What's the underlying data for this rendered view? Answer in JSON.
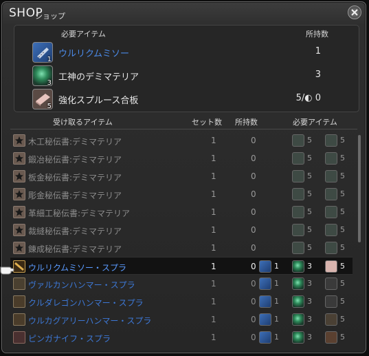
{
  "window": {
    "title": "SHOP",
    "subtitle": "ショップ"
  },
  "required_panel": {
    "col_item": "必要アイテム",
    "col_owned": "所持数",
    "items": [
      {
        "name": "ウルリクムミソー",
        "count": "1",
        "owned": "1",
        "icon": "saw-icon",
        "highlight": true
      },
      {
        "name": "工神のデミマテリア",
        "count": "3",
        "owned": "3",
        "icon": "materia-icon",
        "highlight": false
      },
      {
        "name": "強化スプルース合板",
        "count": "5",
        "owned": "5/◐ 0",
        "icon": "lumber-icon",
        "highlight": false
      }
    ]
  },
  "list": {
    "col_receive": "受け取るアイテム",
    "col_sets": "セット数",
    "col_owned": "所持数",
    "col_required": "必要アイテム",
    "rows": [
      {
        "name": "木工秘伝書:デミマテリア",
        "sets": "1",
        "owned": "0",
        "mats": [
          {
            "icon": "demimateria-icon",
            "n": "5"
          },
          {
            "icon": "demimateria-icon",
            "n": "5"
          }
        ],
        "style": "dim",
        "icon": "star-book-icon"
      },
      {
        "name": "鍛冶秘伝書:デミマテリア",
        "sets": "1",
        "owned": "0",
        "mats": [
          {
            "icon": "demimateria-icon",
            "n": "5"
          },
          {
            "icon": "demimateria-icon",
            "n": "5"
          }
        ],
        "style": "dim",
        "icon": "star-book-icon"
      },
      {
        "name": "板金秘伝書:デミマテリア",
        "sets": "1",
        "owned": "0",
        "mats": [
          {
            "icon": "demimateria-icon",
            "n": "5"
          },
          {
            "icon": "demimateria-icon",
            "n": "5"
          }
        ],
        "style": "dim",
        "icon": "star-book-icon"
      },
      {
        "name": "彫金秘伝書:デミマテリア",
        "sets": "1",
        "owned": "0",
        "mats": [
          {
            "icon": "demimateria-icon",
            "n": "5"
          },
          {
            "icon": "demimateria-icon",
            "n": "5"
          }
        ],
        "style": "dim",
        "icon": "star-book-icon"
      },
      {
        "name": "革細工秘伝書:デミマテリア",
        "sets": "1",
        "owned": "0",
        "mats": [
          {
            "icon": "demimateria-icon",
            "n": "5"
          },
          {
            "icon": "demimateria-icon",
            "n": "5"
          }
        ],
        "style": "dim",
        "icon": "star-book-icon"
      },
      {
        "name": "裁縫秘伝書:デミマテリア",
        "sets": "1",
        "owned": "0",
        "mats": [
          {
            "icon": "demimateria-icon",
            "n": "5"
          },
          {
            "icon": "demimateria-icon",
            "n": "5"
          }
        ],
        "style": "dim",
        "icon": "star-book-icon"
      },
      {
        "name": "錬成秘伝書:デミマテリア",
        "sets": "1",
        "owned": "0",
        "mats": [
          {
            "icon": "demimateria-icon",
            "n": "5"
          },
          {
            "icon": "demimateria-icon",
            "n": "5"
          }
        ],
        "style": "dim",
        "icon": "star-book-icon"
      },
      {
        "name": "ウルリクムミソー・スプラ",
        "sets": "1",
        "owned": "0",
        "mats": [
          {
            "icon": "saw-icon",
            "n": "1"
          },
          {
            "icon": "materia-icon",
            "n": "3"
          },
          {
            "icon": "lumber-icon",
            "n": "5"
          }
        ],
        "style": "selected",
        "icon": "saw-tool-icon"
      },
      {
        "name": "ヴァルカンハンマー・スプラ",
        "sets": "1",
        "owned": "0",
        "mats": [
          {
            "icon": "hammer-icon",
            "n": "1"
          },
          {
            "icon": "materia-icon",
            "n": "3"
          },
          {
            "icon": "ingot-icon",
            "n": "5"
          }
        ],
        "style": "hq",
        "icon": "anvil-icon"
      },
      {
        "name": "クルダレゴンハンマー・スプラ",
        "sets": "1",
        "owned": "0",
        "mats": [
          {
            "icon": "hammer-icon",
            "n": "1"
          },
          {
            "icon": "materia-icon",
            "n": "3"
          },
          {
            "icon": "ingot-icon",
            "n": "5"
          }
        ],
        "style": "hq",
        "icon": "helm-icon"
      },
      {
        "name": "ウルカグアリーハンマー・スプラ",
        "sets": "1",
        "owned": "0",
        "mats": [
          {
            "icon": "hammer-icon",
            "n": "1"
          },
          {
            "icon": "materia-icon",
            "n": "3"
          },
          {
            "icon": "gear-ore-icon",
            "n": "5"
          }
        ],
        "style": "hq",
        "icon": "ring-icon"
      },
      {
        "name": "ピンガナイフ・スプラ",
        "sets": "1",
        "owned": "0",
        "mats": [
          {
            "icon": "knife-icon",
            "n": "1"
          },
          {
            "icon": "materia-icon",
            "n": "3"
          },
          {
            "icon": "leather-icon",
            "n": "5"
          }
        ],
        "style": "hq",
        "icon": "knife-tool-icon"
      }
    ]
  },
  "colors": {
    "hq_blue": "#3d78d6",
    "selected_blue": "#5b9bff",
    "materia_green": "#2e8a5a"
  }
}
